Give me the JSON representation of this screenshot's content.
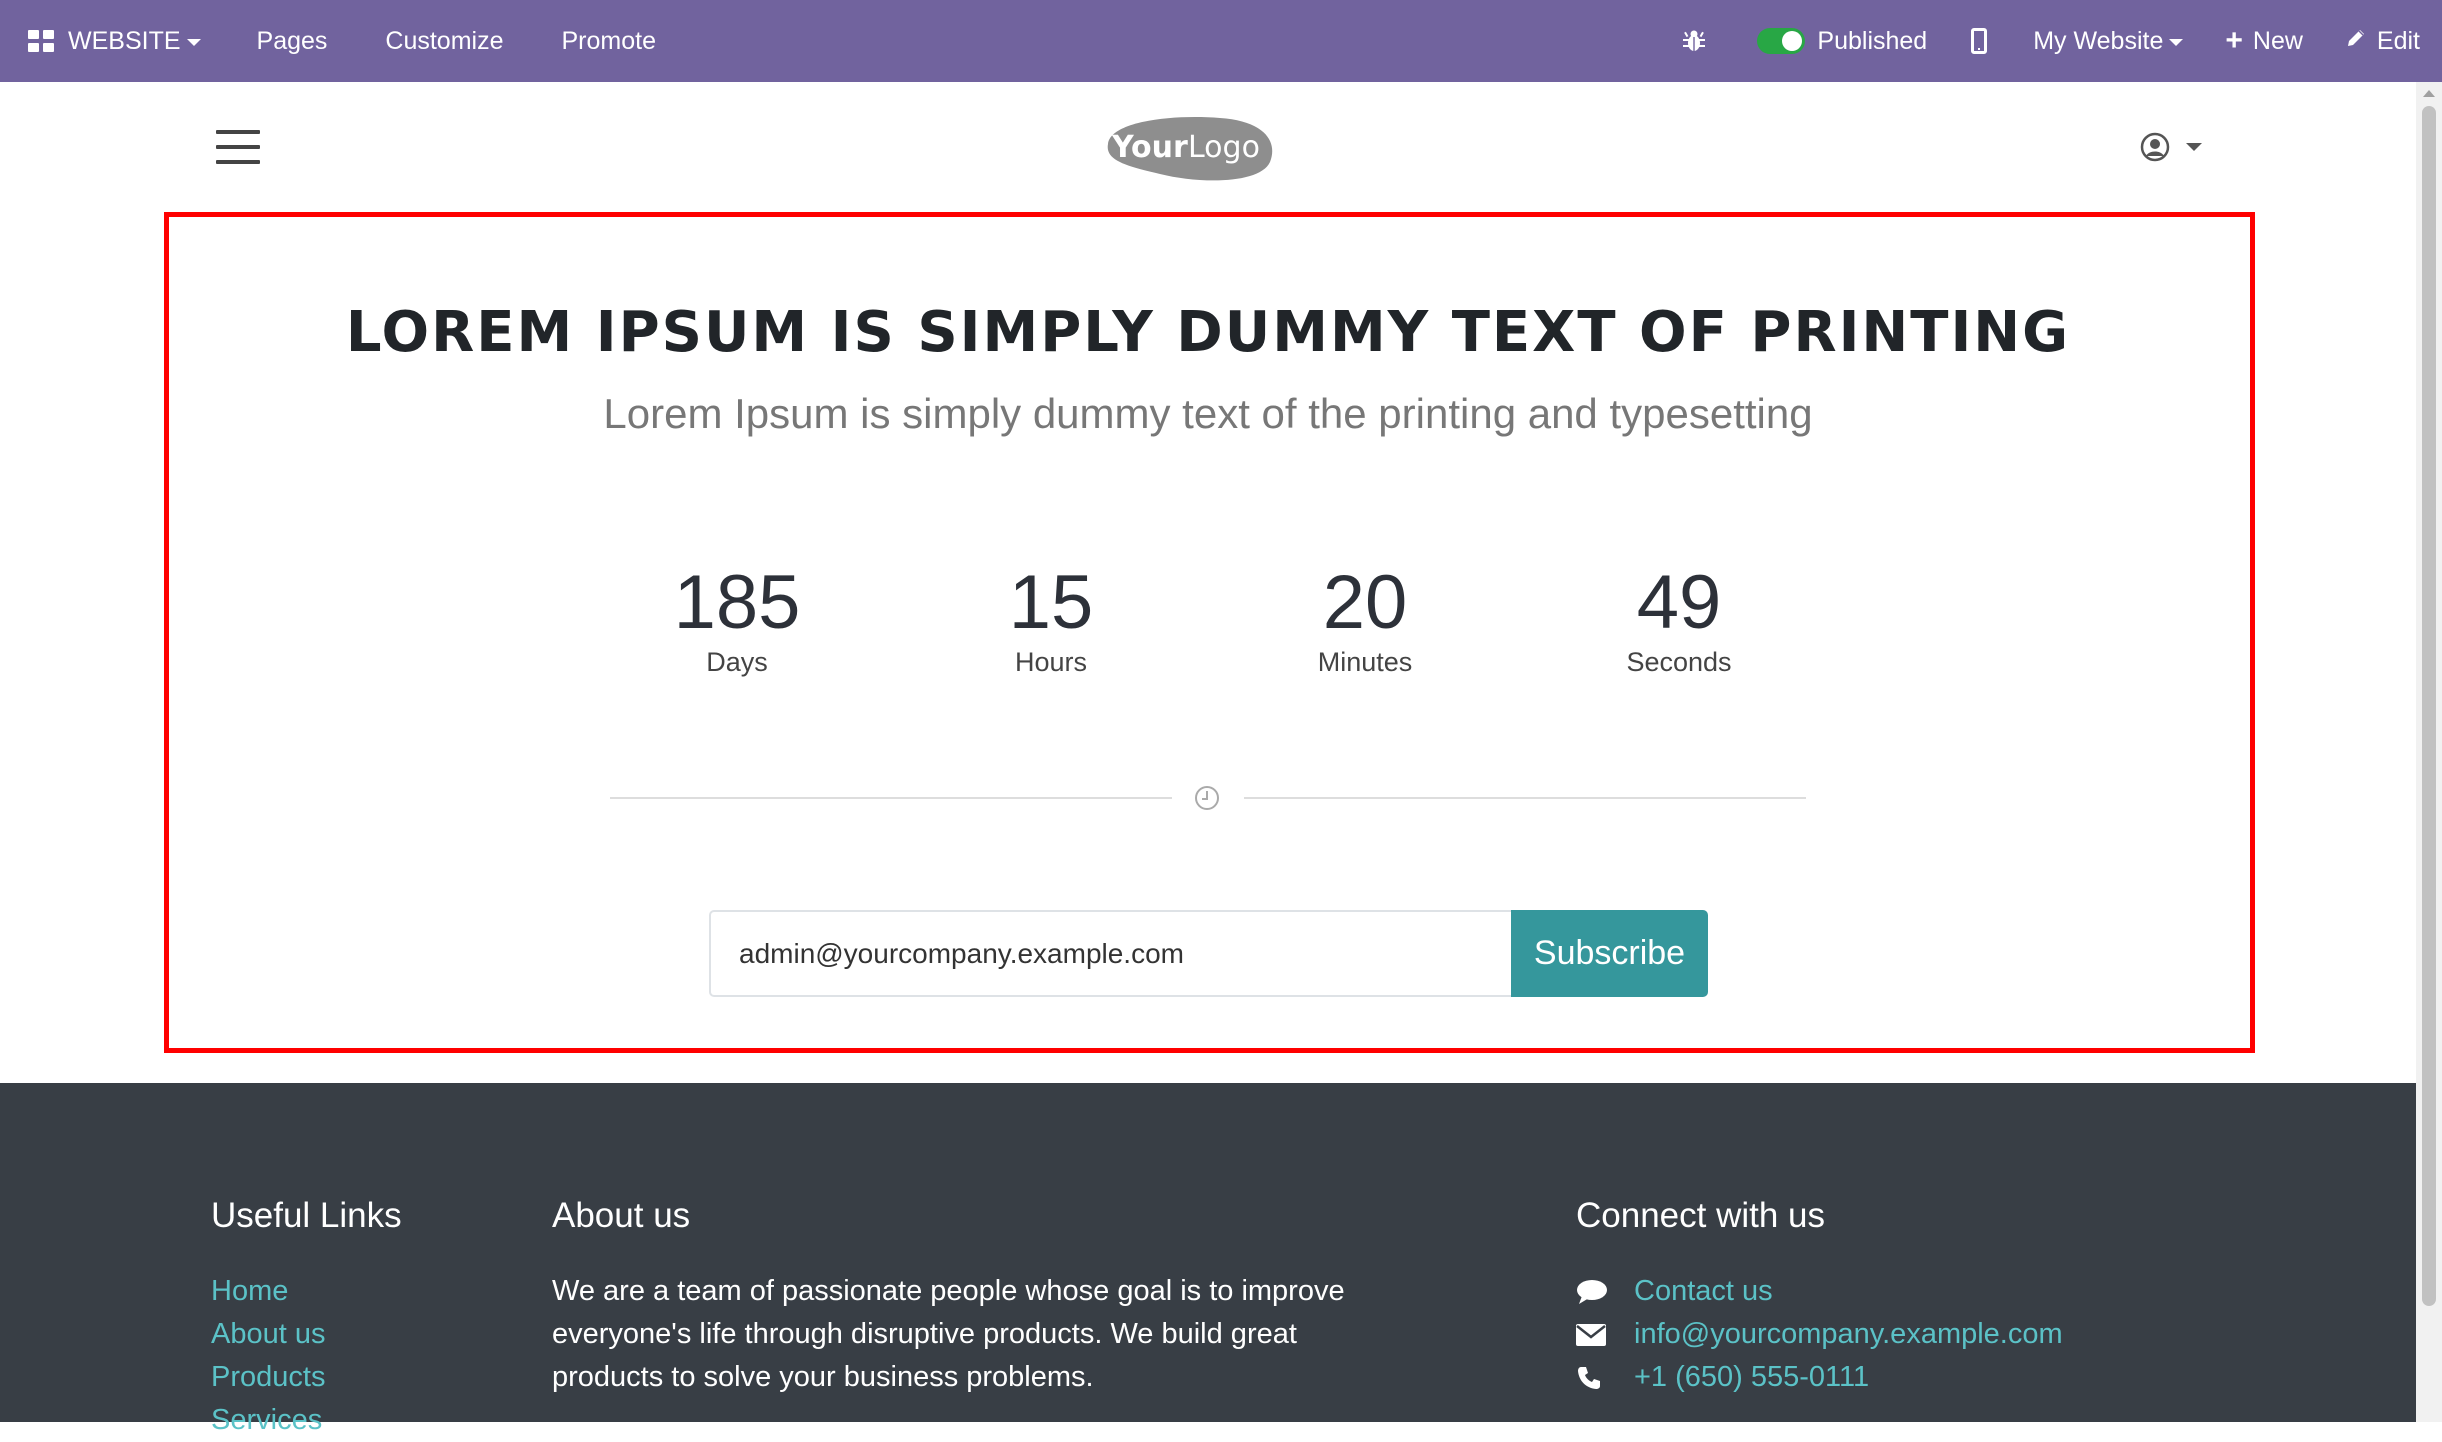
{
  "topbar": {
    "app_menu_label": "WEBSITE",
    "pages_label": "Pages",
    "customize_label": "Customize",
    "promote_label": "Promote",
    "published_label": "Published",
    "website_selector_label": "My Website",
    "new_label": "New",
    "edit_label": "Edit",
    "bg_color": "#71639e"
  },
  "header": {
    "logo_text_bold": "Your",
    "logo_text_light": "Logo"
  },
  "hero": {
    "title": "LOREM IPSUM IS SIMPLY DUMMY TEXT OF PRINTING",
    "subtitle": "Lorem Ipsum is simply dummy text of the printing and typesetting"
  },
  "countdown": {
    "days_value": "185",
    "days_label": "Days",
    "hours_value": "15",
    "hours_label": "Hours",
    "minutes_value": "20",
    "minutes_label": "Minutes",
    "seconds_value": "49",
    "seconds_label": "Seconds"
  },
  "subscribe": {
    "email_value": "admin@yourcompany.example.com",
    "button_label": "Subscribe",
    "button_color": "#35979c"
  },
  "footer": {
    "useful_links_title": "Useful Links",
    "links": [
      "Home",
      "About us",
      "Products",
      "Services"
    ],
    "about_title": "About us",
    "about_text": "We are a team of passionate people whose goal is to improve everyone's life through disruptive products. We build great products to solve your business problems.",
    "connect_title": "Connect with us",
    "contact_label": "Contact us",
    "email": "info@yourcompany.example.com",
    "phone": "+1 (650) 555-0111",
    "bg_color": "#383e45",
    "link_color": "#5bc2c7"
  }
}
